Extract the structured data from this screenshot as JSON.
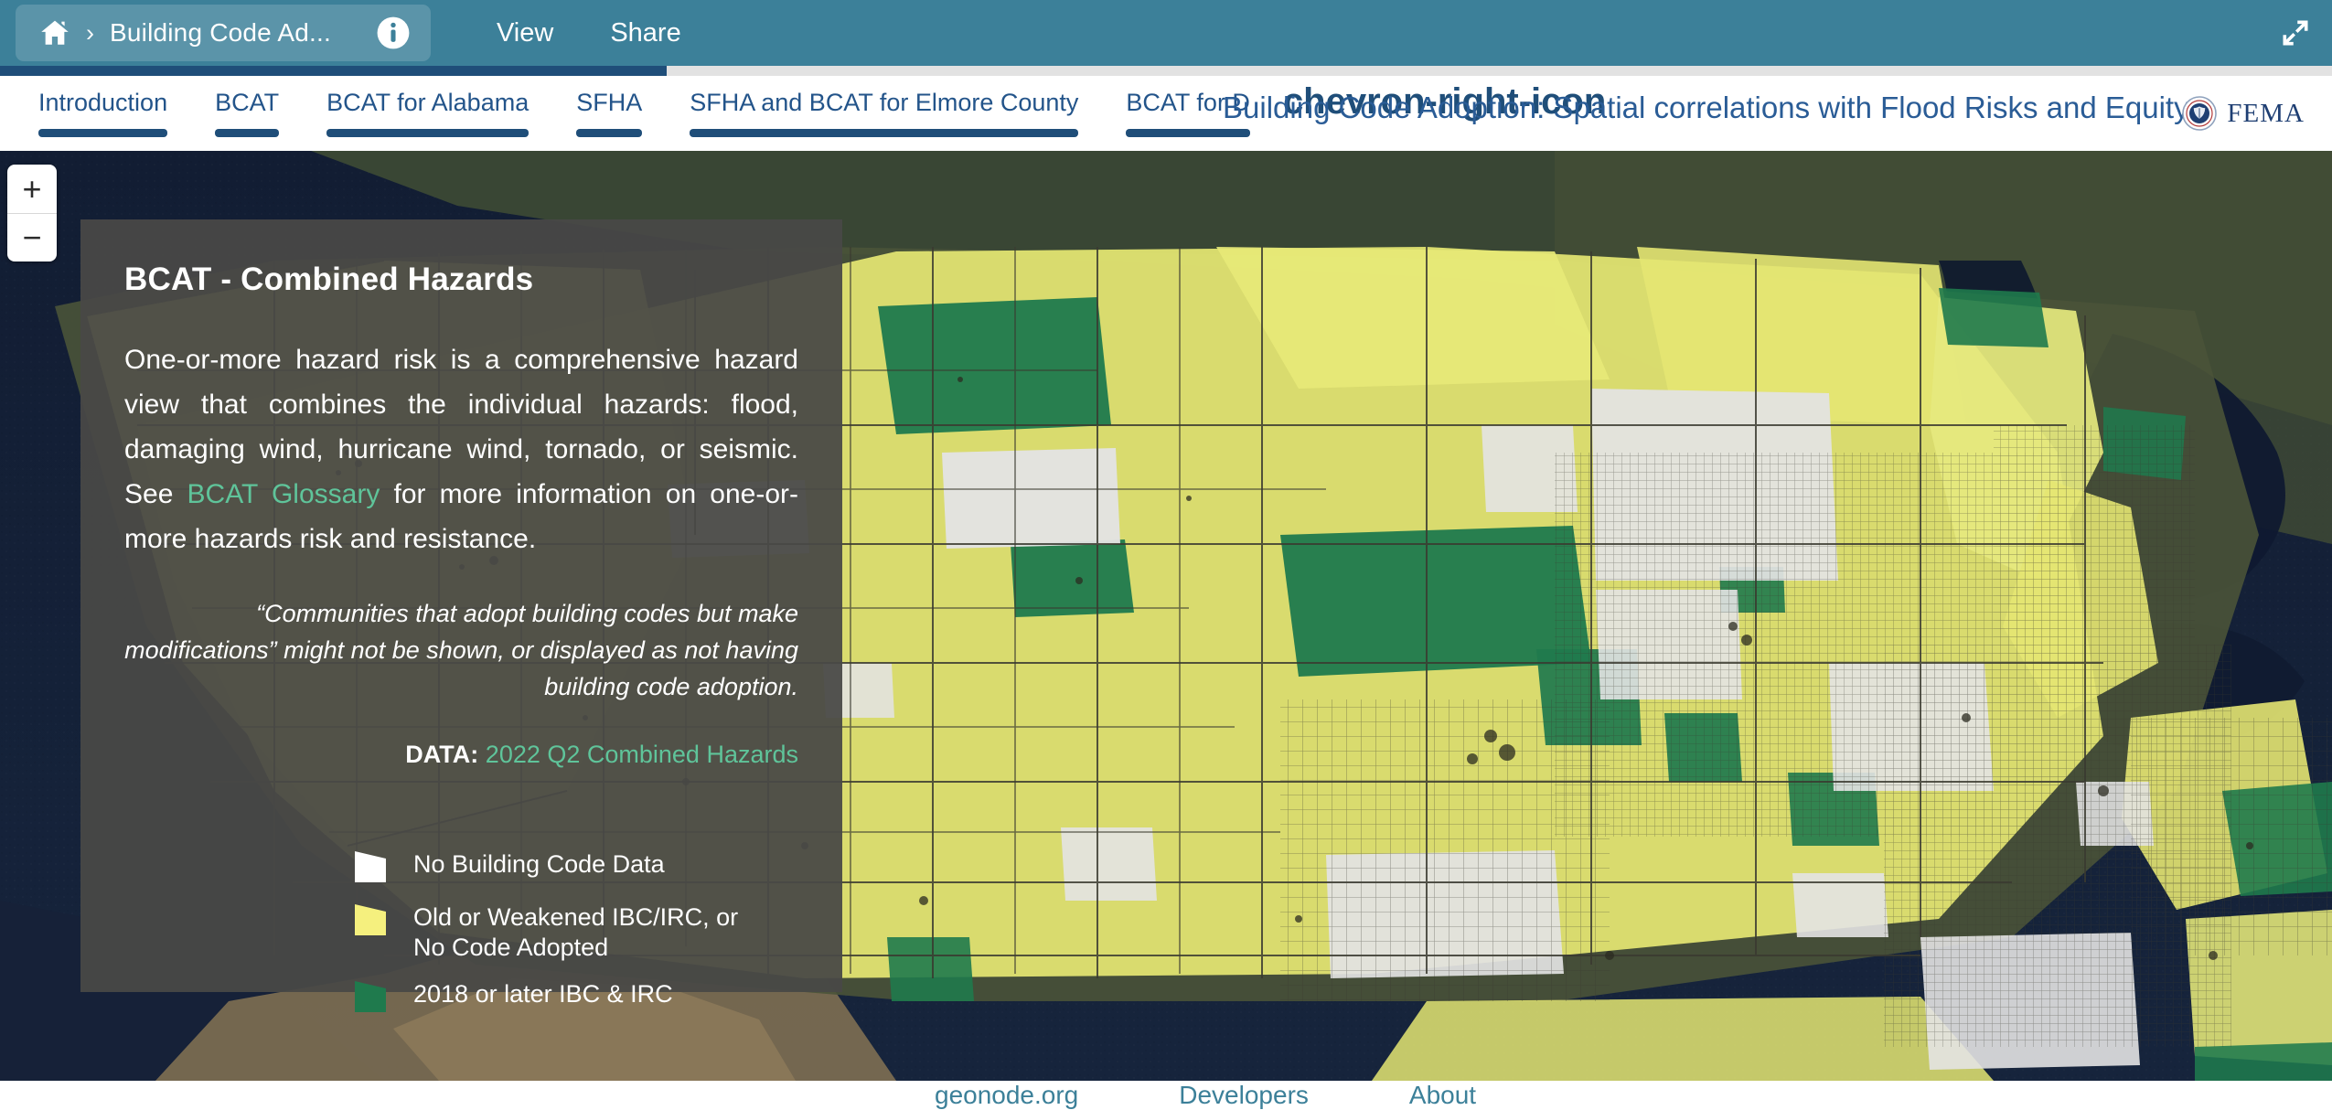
{
  "header": {
    "home_icon": "home-icon",
    "separator": "›",
    "breadcrumb_title": "Building Code Ad...",
    "info_icon": "info-circle-icon",
    "view_label": "View",
    "share_label": "Share",
    "expand_icon": "expand-arrows-icon",
    "bar_color": "#3c8099"
  },
  "progress": {
    "percent": 29,
    "fill_color": "#1f4e79",
    "track_color": "#e2e2e2"
  },
  "tabs": [
    {
      "label": "Introduction"
    },
    {
      "label": "BCAT"
    },
    {
      "label": "BCAT for Alabama"
    },
    {
      "label": "SFHA"
    },
    {
      "label": "SFHA and BCAT for Elmore County"
    },
    {
      "label": "BCAT for D"
    }
  ],
  "tabs_next_icon": "chevron-right-icon",
  "deck_title": "Building Code Adoption: Spatial correlations with Flood Risks and Equity",
  "brand": {
    "name": "FEMA",
    "seal_icon": "fema-seal-icon"
  },
  "zoom_control": {
    "zoom_in": "+",
    "zoom_out": "−"
  },
  "panel": {
    "title": "BCAT - Combined Hazards",
    "body_part1": "One-or-more hazard risk is a comprehensive hazard view that combines the individual hazards: flood, damaging wind, hurricane wind, tornado, or seismic. See ",
    "body_link": "BCAT Glossary",
    "body_part2": " for more information on one-or-more hazards risk and resistance.",
    "note": "“Communities that adopt building codes but make modifications” might not be shown, or displayed as not having building code adoption.",
    "data_label": "DATA:",
    "data_value": "2022 Q2 Combined Hazards",
    "accent_color": "#5fc49a",
    "background_color": "#484846"
  },
  "legend": {
    "items": [
      {
        "label": "No Building Code Data",
        "color": "#ffffff"
      },
      {
        "label": "Old or Weakened IBC/IRC, or\nNo Code Adopted",
        "color": "#f5f07e"
      },
      {
        "label": "2018 or later IBC & IRC",
        "color": "#1f7a4d"
      }
    ]
  },
  "footer": {
    "links": [
      {
        "label": "geonode.org"
      },
      {
        "label": "Developers"
      },
      {
        "label": "About"
      }
    ],
    "link_color": "#3c8099"
  },
  "map": {
    "basemap": "satellite-imagery",
    "water_color": "#16213a",
    "land_color": "#3f4a32",
    "no_data_color": "#e3e3e3",
    "old_code_color": "#e8e86a",
    "new_code_color": "#1f7a4d",
    "boundary_color": "#3a3a30"
  }
}
